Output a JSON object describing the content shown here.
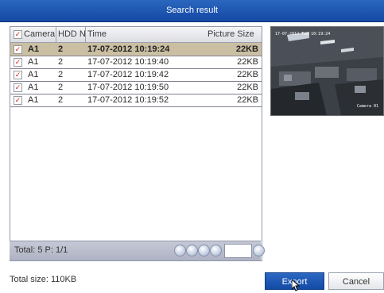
{
  "window": {
    "title": "Search result"
  },
  "table": {
    "columns": [
      "Camera",
      "HDD N",
      "Time",
      "Picture Size"
    ],
    "header_checked": true,
    "rows": [
      {
        "checked": true,
        "camera": "A1",
        "hdd": "2",
        "time": "17-07-2012 10:19:24",
        "size": "22KB",
        "selected": true
      },
      {
        "checked": true,
        "camera": "A1",
        "hdd": "2",
        "time": "17-07-2012 10:19:40",
        "size": "22KB",
        "selected": false
      },
      {
        "checked": true,
        "camera": "A1",
        "hdd": "2",
        "time": "17-07-2012 10:19:42",
        "size": "22KB",
        "selected": false
      },
      {
        "checked": true,
        "camera": "A1",
        "hdd": "2",
        "time": "17-07-2012 10:19:50",
        "size": "22KB",
        "selected": false
      },
      {
        "checked": true,
        "camera": "A1",
        "hdd": "2",
        "time": "17-07-2012 10:19:52",
        "size": "22KB",
        "selected": false
      }
    ]
  },
  "footer": {
    "total_label": "Total: 5  P: 1/1",
    "page_input": ""
  },
  "preview": {
    "timestamp": "17-07-2012 Tue 10:19:24",
    "camera_label": "Camera 01"
  },
  "summary": {
    "total_size": "Total size: 110KB"
  },
  "buttons": {
    "export": "Export",
    "cancel": "Cancel"
  },
  "colors": {
    "title_bar": "#1a52ad",
    "selected_row": "#cbbfa3",
    "checkmark": "#d0252a"
  },
  "icons": {
    "nav": [
      "first-page-icon",
      "prev-page-icon",
      "next-page-icon",
      "last-page-icon",
      "go-page-icon"
    ]
  }
}
